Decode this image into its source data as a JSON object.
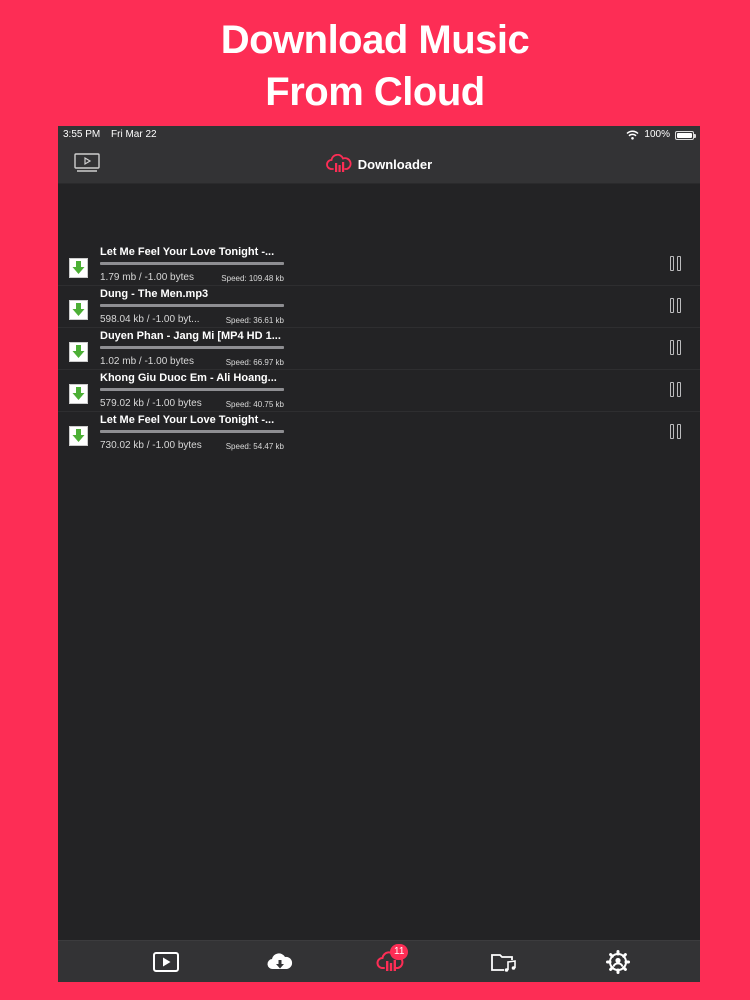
{
  "promo": {
    "line1": "Download Music",
    "line2": "From Cloud"
  },
  "status_bar": {
    "time": "3:55 PM",
    "date": "Fri Mar 22",
    "battery": "100%"
  },
  "nav": {
    "title": "Downloader",
    "left_icon": "tv-play-icon",
    "title_icon": "cloud-download-icon"
  },
  "downloads": [
    {
      "name": "Let Me Feel Your Love Tonight -...",
      "size": "1.79 mb / -1.00 bytes",
      "speed": "Speed: 109.48 kb",
      "progress": 1.0
    },
    {
      "name": "Dung - The Men.mp3",
      "size": "598.04 kb / -1.00 byt...",
      "speed": "Speed: 36.61 kb",
      "progress": 1.0
    },
    {
      "name": "Duyen Phan - Jang Mi [MP4 HD 1...",
      "size": "1.02 mb / -1.00 bytes",
      "speed": "Speed: 66.97 kb",
      "progress": 1.0
    },
    {
      "name": "Khong Giu Duoc Em - Ali Hoang...",
      "size": "579.02 kb / -1.00 bytes",
      "speed": "Speed: 40.75 kb",
      "progress": 1.0
    },
    {
      "name": "Let Me Feel Your Love Tonight -...",
      "size": "730.02 kb / -1.00 bytes",
      "speed": "Speed: 54.47 kb",
      "progress": 1.0
    }
  ],
  "tabbar": {
    "tabs": [
      {
        "icon": "video-icon"
      },
      {
        "icon": "cloud-download-icon"
      },
      {
        "icon": "downloader-icon",
        "badge": "11",
        "active": true
      },
      {
        "icon": "music-folder-icon"
      },
      {
        "icon": "settings-icon"
      }
    ]
  },
  "colors": {
    "accent": "#fd2d55",
    "background": "#232325",
    "bar": "#333335",
    "download_green": "#4caf35"
  }
}
